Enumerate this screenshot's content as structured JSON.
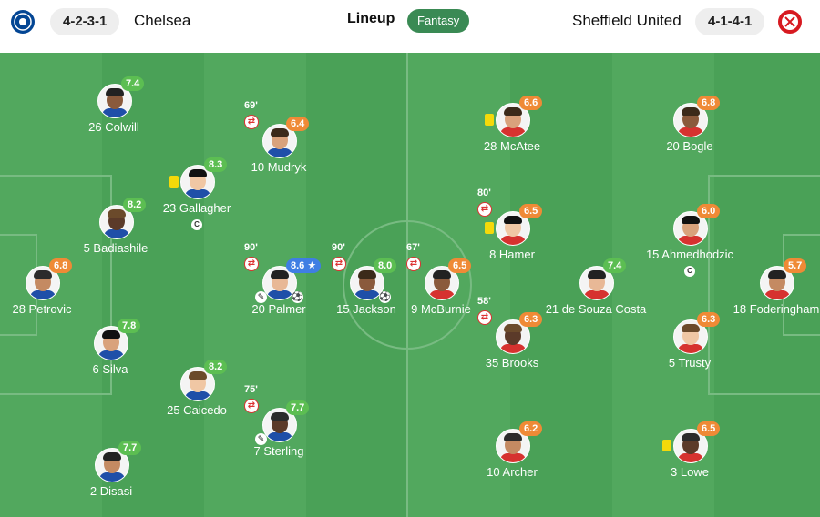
{
  "header": {
    "home": {
      "formation": "4-2-3-1",
      "name": "Chelsea",
      "crest_color": "#034694"
    },
    "away": {
      "formation": "4-1-4-1",
      "name": "Sheffield United",
      "crest_color": "#d71920"
    },
    "tabs": {
      "lineup": "Lineup",
      "fantasy": "Fantasy"
    }
  },
  "colors": {
    "pitch": "#4aa157",
    "rating_green": "#5cbe52",
    "rating_orange": "#ef8a36",
    "rating_blue": "#3f7ee3"
  },
  "home_players": [
    {
      "name": "26 Colwill",
      "rating": "7.4",
      "rating_color": "green"
    },
    {
      "name": "10 Mudryk",
      "rating": "6.4",
      "rating_color": "orange",
      "sub_minute": "69'",
      "sub_icon": "substitution-out-icon"
    },
    {
      "name": "23 Gallagher",
      "rating": "8.3",
      "rating_color": "green",
      "yellow_card": true,
      "captain": "C"
    },
    {
      "name": "5 Badiashile",
      "rating": "8.2",
      "rating_color": "green"
    },
    {
      "name": "28 Petrovic",
      "rating": "6.8",
      "rating_color": "orange"
    },
    {
      "name": "20 Palmer",
      "rating": "8.6 ★",
      "rating_color": "blue",
      "sub_minute": "90'",
      "sub_icon": "substitution-out-icon",
      "assist": true,
      "goal": true
    },
    {
      "name": "15 Jackson",
      "rating": "8.0",
      "rating_color": "green",
      "sub_minute": "90'",
      "sub_icon": "substitution-out-icon",
      "goal": true
    },
    {
      "name": "6 Silva",
      "rating": "7.8",
      "rating_color": "green"
    },
    {
      "name": "25 Caicedo",
      "rating": "8.2",
      "rating_color": "green"
    },
    {
      "name": "7 Sterling",
      "rating": "7.7",
      "rating_color": "green",
      "sub_minute": "75'",
      "sub_icon": "substitution-out-icon",
      "assist": true
    },
    {
      "name": "2 Disasi",
      "rating": "7.7",
      "rating_color": "green"
    }
  ],
  "away_players": [
    {
      "name": "9 McBurnie",
      "rating": "6.5",
      "rating_color": "orange",
      "sub_minute": "67'",
      "sub_icon": "substitution-out-icon"
    },
    {
      "name": "28 McAtee",
      "rating": "6.6",
      "rating_color": "orange",
      "yellow_card": true
    },
    {
      "name": "8 Hamer",
      "rating": "6.5",
      "rating_color": "orange",
      "sub_minute": "80'",
      "sub_icon": "substitution-out-icon",
      "yellow_card": true
    },
    {
      "name": "35 Brooks",
      "rating": "6.3",
      "rating_color": "orange",
      "sub_minute": "58'",
      "sub_icon": "substitution-out-icon"
    },
    {
      "name": "10 Archer",
      "rating": "6.2",
      "rating_color": "orange"
    },
    {
      "name": "21 de Souza Costa",
      "rating": "7.4",
      "rating_color": "green"
    },
    {
      "name": "20 Bogle",
      "rating": "6.8",
      "rating_color": "orange"
    },
    {
      "name": "15 Ahmedhodzic",
      "rating": "6.0",
      "rating_color": "orange",
      "captain": "C"
    },
    {
      "name": "5 Trusty",
      "rating": "6.3",
      "rating_color": "orange"
    },
    {
      "name": "3 Lowe",
      "rating": "6.5",
      "rating_color": "orange",
      "yellow_card": true
    },
    {
      "name": "18 Foderingham",
      "rating": "5.7",
      "rating_color": "orange"
    }
  ]
}
